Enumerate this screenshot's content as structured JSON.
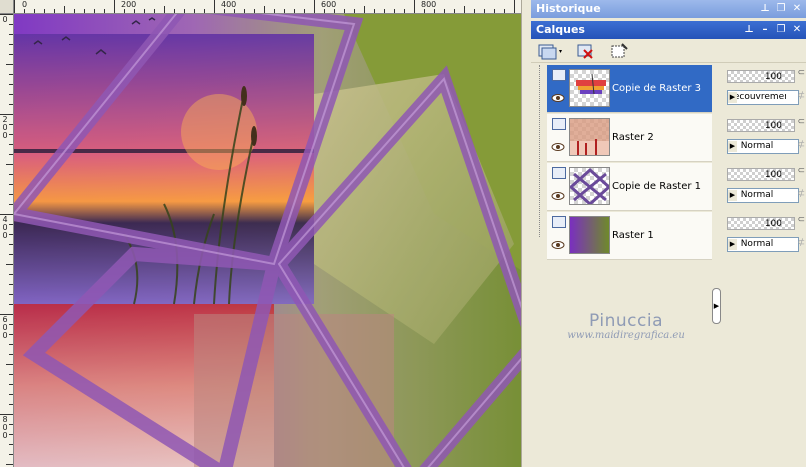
{
  "ruler_top_labels": [
    "0",
    "200",
    "400",
    "600",
    "800"
  ],
  "ruler_left_labels": [
    "0",
    "2\n0\n0",
    "4\n0\n0",
    "6\n0\n0",
    "8\n0\n0"
  ],
  "history_panel": {
    "title": "Historique"
  },
  "layers_panel": {
    "title": "Calques",
    "layers": [
      {
        "name": "Copie de Raster 3",
        "opacity": "100",
        "blend": "Recouvrement",
        "selected": true
      },
      {
        "name": "Raster 2",
        "opacity": "100",
        "blend": "Normal",
        "selected": false
      },
      {
        "name": "Copie de Raster 1",
        "opacity": "100",
        "blend": "Normal",
        "selected": false
      },
      {
        "name": "Raster 1",
        "opacity": "100",
        "blend": "Normal",
        "selected": false
      }
    ]
  },
  "watermark": {
    "name": "Pinuccia",
    "url": "www.maidiregrafica.eu"
  },
  "colors": {
    "title_active": "#2553b8",
    "title_inactive": "#7a9ddd",
    "selection": "#316ac5",
    "frame_purple": "#8a4fb0"
  },
  "icons": [
    "pin-icon",
    "restore-icon",
    "close-icon",
    "new-layer-icon",
    "delete-layer-icon",
    "properties-icon",
    "eye-icon",
    "lock-icon"
  ]
}
